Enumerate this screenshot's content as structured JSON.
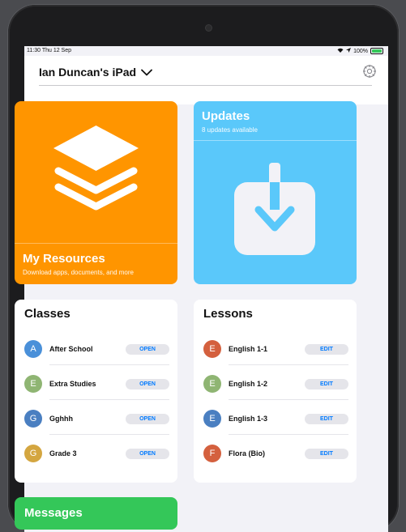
{
  "status": {
    "time": "11:30  Thu 12 Sep",
    "battery": "100%"
  },
  "header": {
    "device_name": "Ian Duncan's iPad"
  },
  "resources": {
    "title": "My Resources",
    "subtitle": "Download apps, documents, and more"
  },
  "updates": {
    "title": "Updates",
    "subtitle": "8 updates available"
  },
  "classes": {
    "title": "Classes",
    "items": [
      {
        "initial": "A",
        "name": "After School",
        "action": "OPEN",
        "color": "#4a90d9"
      },
      {
        "initial": "E",
        "name": "Extra Studies",
        "action": "OPEN",
        "color": "#8fb573"
      },
      {
        "initial": "G",
        "name": "Gghhh",
        "action": "OPEN",
        "color": "#4a7fc1"
      },
      {
        "initial": "G",
        "name": "Grade 3",
        "action": "OPEN",
        "color": "#d4a640"
      }
    ]
  },
  "lessons": {
    "title": "Lessons",
    "items": [
      {
        "initial": "E",
        "name": "English 1-1",
        "action": "EDIT",
        "color": "#d4603e"
      },
      {
        "initial": "E",
        "name": "English 1-2",
        "action": "EDIT",
        "color": "#8fb573"
      },
      {
        "initial": "E",
        "name": "English 1-3",
        "action": "EDIT",
        "color": "#4a7fc1"
      },
      {
        "initial": "F",
        "name": "Flora (Bio)",
        "action": "EDIT",
        "color": "#d4603e"
      }
    ]
  },
  "messages": {
    "title": "Messages"
  },
  "colors": {
    "resources": "#ff9500",
    "updates": "#5ac8fa",
    "messages": "#34c759",
    "accent": "#007aff"
  }
}
